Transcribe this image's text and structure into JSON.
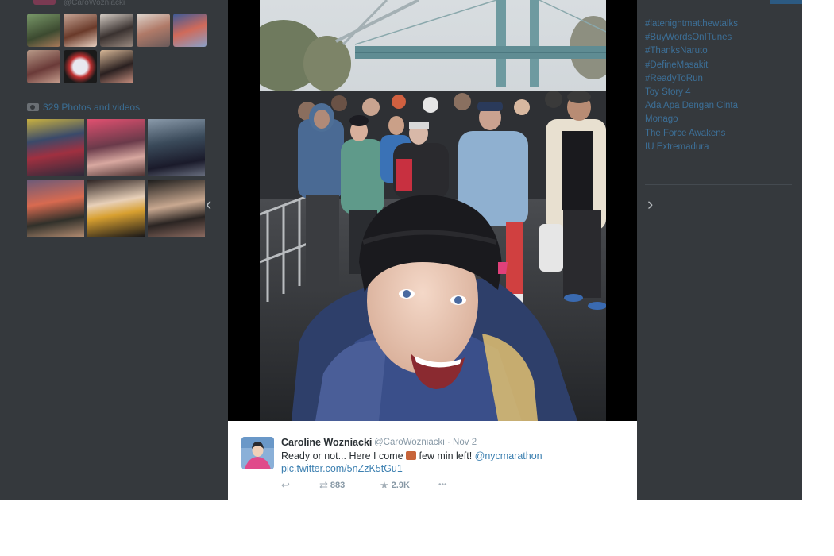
{
  "left_panel": {
    "handle_partial": "@CaroWozniacki",
    "photos_videos_label": "329 Photos and videos"
  },
  "trends": [
    "#latenightmatthewtalks",
    "#BuyWordsOnITunes",
    "#ThanksNaruto",
    "#DefineMasakit",
    "#ReadyToRun",
    "Toy Story 4",
    "Ada Apa Dengan Cinta",
    "Monago",
    "The Force Awakens",
    "IU Extremadura"
  ],
  "nav": {
    "prev_glyph": "‹",
    "next_glyph": "›"
  },
  "tweet": {
    "name": "Caroline Wozniacki",
    "handle": "@CaroWozniacki",
    "separator": "·",
    "date": "Nov 2",
    "text_before": "Ready or not... Here I come ",
    "text_after": " few min left! ",
    "mention": "@nycmarathon",
    "pic_link": "pic.twitter.com/5nZzK5tGu1",
    "reply_glyph": "↩",
    "retweet_glyph": "⇄",
    "retweet_count": "883",
    "favorite_glyph": "★",
    "favorite_count": "2.9K",
    "more_glyph": "•••"
  },
  "colors": {
    "overlay": "#35393d",
    "link": "#3b7fb0",
    "trend_link": "#3c6f97",
    "muted": "#8899a6"
  },
  "icons": [
    "camera-icon",
    "chevron-left-icon",
    "chevron-right-icon",
    "reply-icon",
    "retweet-icon",
    "star-icon",
    "more-icon"
  ]
}
